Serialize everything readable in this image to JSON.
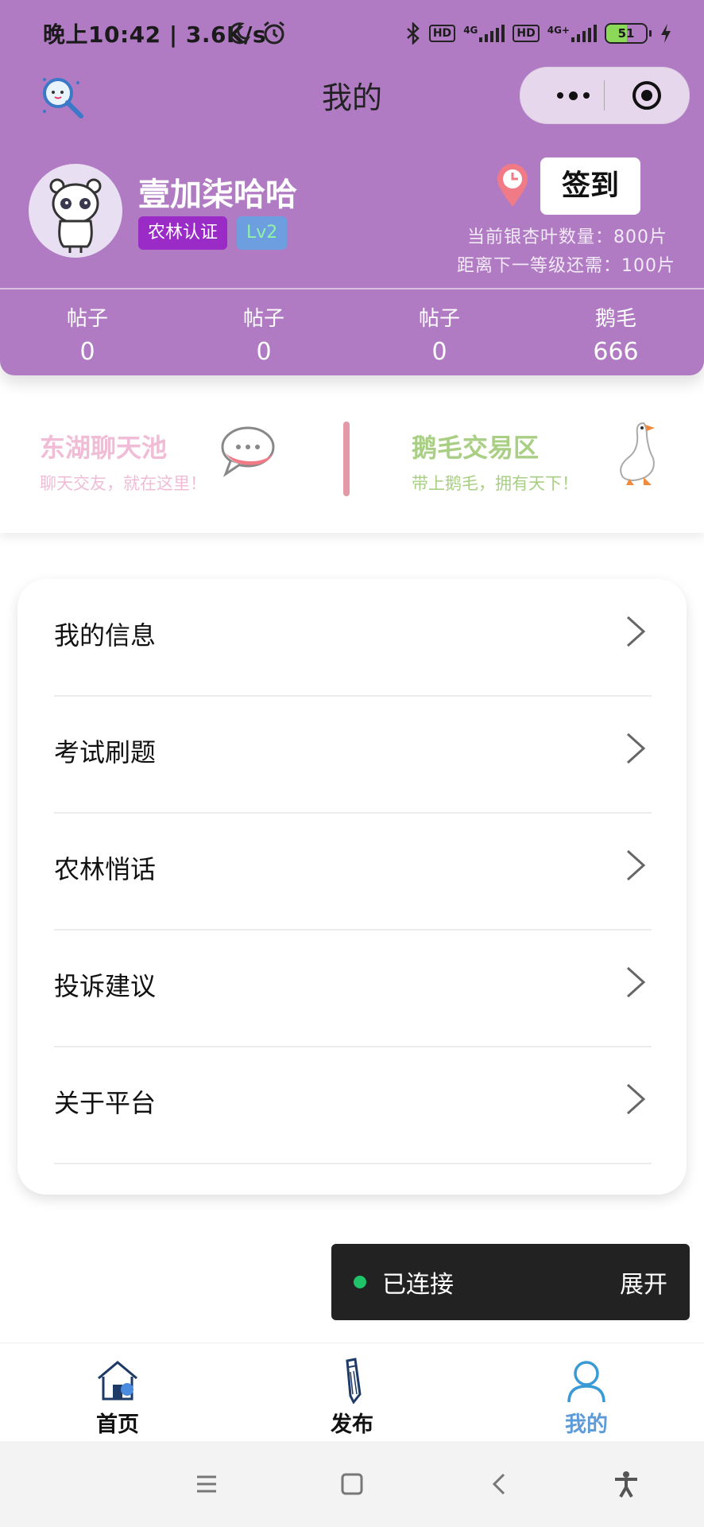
{
  "status_bar": {
    "left_text": "晚上10:42 | 3.6K/s",
    "hd_label": "HD",
    "net_1": "4G",
    "net_2": "4G+",
    "battery": "51"
  },
  "nav": {
    "title": "我的"
  },
  "profile": {
    "username": "壹加柒哈哈",
    "cert_badge": "农林认证",
    "level_badge": "Lv2",
    "checkin_label": "签到",
    "leaf_count": "当前银杏叶数量：800片",
    "next_level": "距离下一等级还需：100片"
  },
  "stats": [
    {
      "label": "帖子",
      "value": "0"
    },
    {
      "label": "帖子",
      "value": "0"
    },
    {
      "label": "帖子",
      "value": "0"
    },
    {
      "label": "鹅毛",
      "value": "666"
    }
  ],
  "quick": {
    "chat_title": "东湖聊天池",
    "chat_sub": "聊天交友，就在这里！",
    "trade_title": "鹅毛交易区",
    "trade_sub": "带上鹅毛，拥有天下！"
  },
  "menu": [
    {
      "label": "我的信息"
    },
    {
      "label": "考试刷题"
    },
    {
      "label": "农林悄话"
    },
    {
      "label": "投诉建议"
    },
    {
      "label": "关于平台"
    }
  ],
  "toast": {
    "text": "已连接",
    "expand": "展开"
  },
  "tabbar": [
    {
      "label": "首页",
      "icon": "home-icon"
    },
    {
      "label": "发布",
      "icon": "pencil-icon"
    },
    {
      "label": "我的",
      "icon": "user-icon",
      "active": true
    }
  ],
  "colors": {
    "header": "#b07bc3",
    "cert_badge": "#9b2bc7",
    "level_badge": "#6c9ee0",
    "chat_accent": "#f0bcd6",
    "trade_accent": "#a9cf84",
    "active_tab": "#5c9bd8",
    "toast_dot": "#1ec467"
  }
}
